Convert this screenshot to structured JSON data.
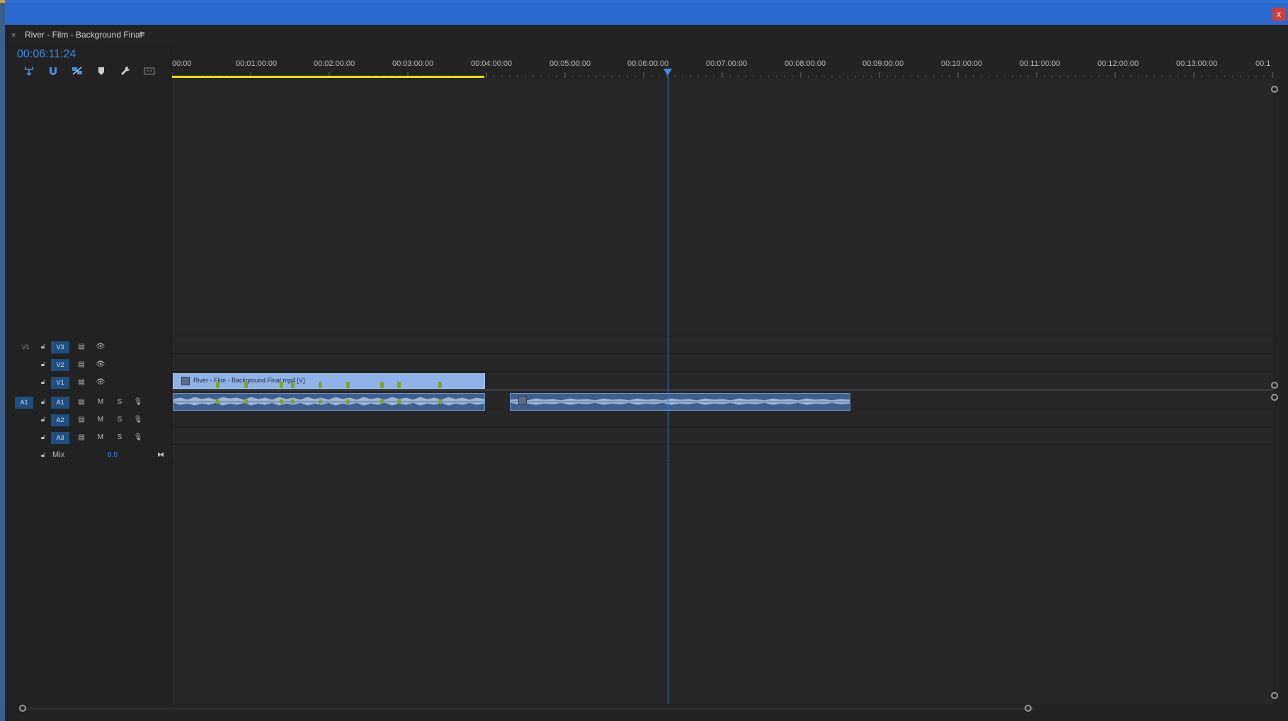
{
  "window": {
    "close_label": "x"
  },
  "panel": {
    "close_label": "×",
    "title": "River - Film - Background Final",
    "menu_label": "≡"
  },
  "timecode": "00:06:11:24",
  "toolbar": {
    "tools": [
      {
        "name": "insert-nest-icon"
      },
      {
        "name": "snap-magnet-icon"
      },
      {
        "name": "linked-selection-icon"
      },
      {
        "name": "add-marker-icon"
      },
      {
        "name": "wrench-settings-icon"
      },
      {
        "name": "captions-icon"
      }
    ]
  },
  "ruler": {
    "labels": [
      "00:00",
      "00:01:00:00",
      "00:02:00:00",
      "00:03:00:00",
      "00:04:00:00",
      "00:05:00:00",
      "00:06:00:00",
      "00:07:00:00",
      "00:08:00:00",
      "00:09:00:00",
      "00:10:00:00",
      "00:11:00:00",
      "00:12:00:00",
      "00:13:00:00",
      "00:1"
    ]
  },
  "tracks": {
    "video": [
      {
        "source_label": "V1",
        "label": "V3"
      },
      {
        "source_label": "",
        "label": "V2"
      },
      {
        "source_label": "",
        "label": "V1"
      }
    ],
    "audio": [
      {
        "source_label": "A1",
        "label": "A1",
        "m": "M",
        "s": "S"
      },
      {
        "source_label": "",
        "label": "A2",
        "m": "M",
        "s": "S"
      },
      {
        "source_label": "",
        "label": "A3",
        "m": "M",
        "s": "S"
      }
    ],
    "mix": {
      "label": "Mix",
      "value": "0.0"
    }
  },
  "clips": {
    "video_clip_label": "River - Film - Background Final.mp4 [V]"
  },
  "colors": {
    "accent": "#3b8fe8",
    "titlebar": "#2a6ad0",
    "work_area": "#e8e000",
    "video_clip": "#8fb3e8",
    "audio_clip": "#3e5f8d",
    "marker": "#7ea42e"
  }
}
